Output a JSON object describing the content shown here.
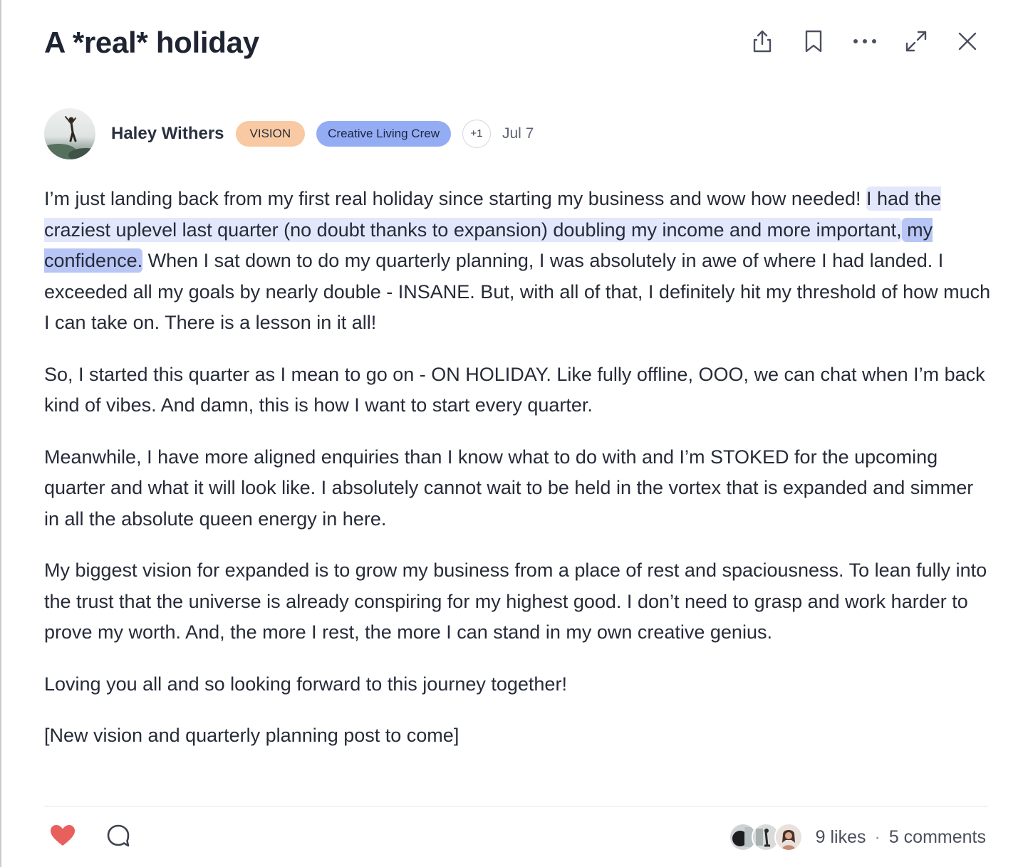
{
  "post": {
    "title": "A *real* holiday",
    "author": "Haley Withers",
    "badges": {
      "vision": "VISION",
      "crew": "Creative Living Crew",
      "more": "+1"
    },
    "date": "Jul 7"
  },
  "header": {
    "actions": [
      "share-icon",
      "bookmark-icon",
      "more-icon",
      "expand-icon",
      "close-icon"
    ]
  },
  "body": {
    "p1": {
      "a": "I’m just landing back from my first real holiday since starting my business and wow how needed! ",
      "hl1": "I had the craziest uplevel last quarter (no doubt thanks to expansion) doubling my income and more important,",
      "hl2": " my confidence.",
      "b": " When I sat down to do my quarterly planning, I was absolutely in awe of where I had landed. I exceeded all my goals by nearly double - INSANE. But, with all of that, I definitely hit my threshold of how much I can take on. There is a lesson in it all!"
    },
    "p2": "So, I started this quarter as I mean to go on - ON HOLIDAY. Like fully offline, OOO, we can chat when I’m back kind of vibes. And damn, this is how I want to start every quarter.",
    "p3": "Meanwhile, I have more aligned enquiries than I know what to do with and I’m STOKED for the upcoming quarter and what it will look like. I absolutely cannot wait to be held in the vortex that is expanded and simmer in all the absolute queen energy in here.",
    "p4": "My biggest vision for expanded is to grow my business from a place of rest and spaciousness. To lean fully into the trust that the universe is already conspiring for my highest good. I don’t need to grasp and work harder to prove my worth. And, the more I rest, the more I can stand in my own creative genius.",
    "p5": "Loving you all and so looking forward to this journey together!",
    "p6": "[New vision and quarterly planning post to come]"
  },
  "footer": {
    "likes": "9 likes",
    "separator": "·",
    "comments": "5 comments",
    "liked": true,
    "colors": {
      "heart": "#e8605c"
    }
  },
  "colors": {
    "vision_badge": "#f8c9a2",
    "crew_badge": "#94acf4",
    "highlight": "#e2e7fb",
    "highlight_strong": "#b8c6f6"
  }
}
